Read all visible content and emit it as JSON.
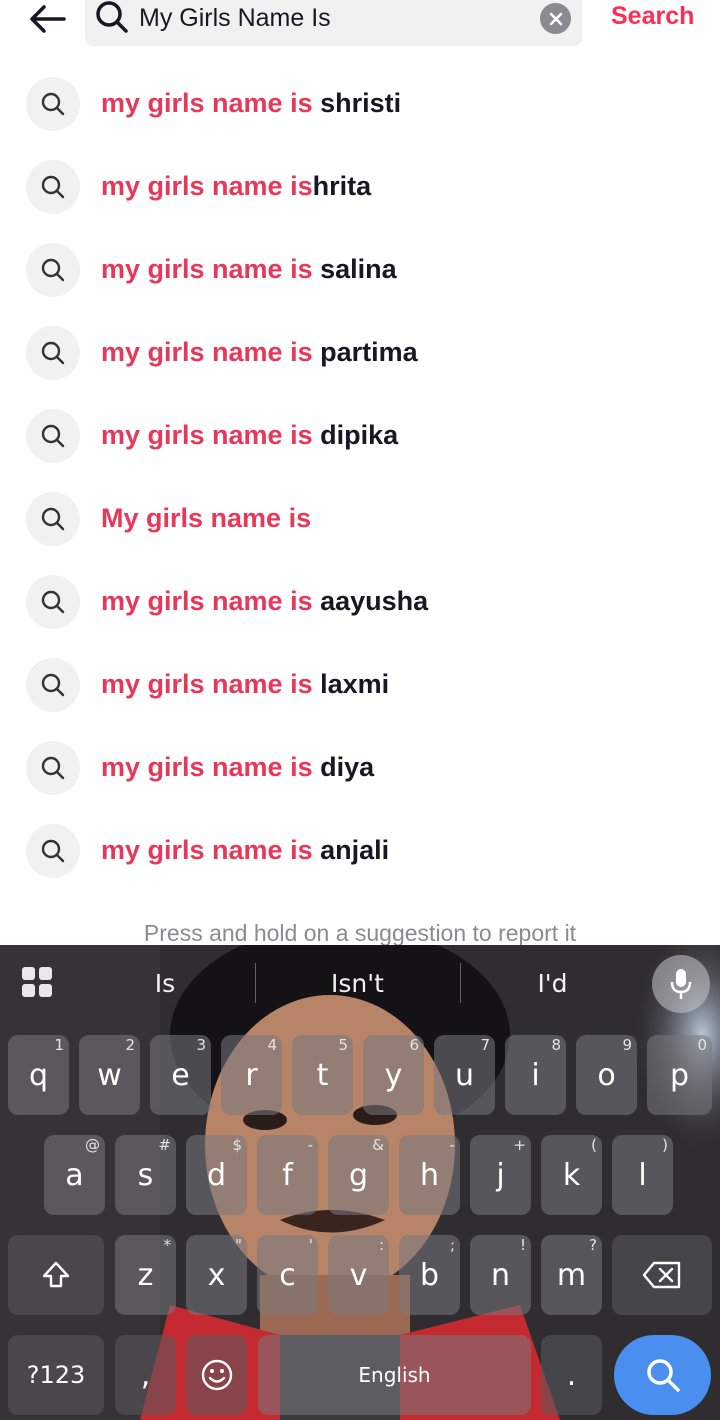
{
  "header": {
    "search_value": "My Girls Name Is",
    "search_action_label": "Search"
  },
  "suggestions": [
    {
      "highlight": "my girls name is",
      "rest": " shristi"
    },
    {
      "highlight": "my girls name is",
      "rest": "hrita"
    },
    {
      "highlight": "my girls name is",
      "rest": " salina"
    },
    {
      "highlight": "my girls name is",
      "rest": " partima"
    },
    {
      "highlight": "my girls name is",
      "rest": " dipika"
    },
    {
      "highlight": "My girls name is",
      "rest": ""
    },
    {
      "highlight": "my girls name is",
      "rest": " aayusha"
    },
    {
      "highlight": "my girls name is",
      "rest": " laxmi"
    },
    {
      "highlight": "my girls name is",
      "rest": " diya"
    },
    {
      "highlight": "my girls name is",
      "rest": " anjali"
    }
  ],
  "report_hint": "Press and hold on a suggestion to report it",
  "keyboard": {
    "predictions": [
      "Is",
      "Isn't",
      "I'd"
    ],
    "row1": [
      {
        "k": "q",
        "h": "1"
      },
      {
        "k": "w",
        "h": "2"
      },
      {
        "k": "e",
        "h": "3"
      },
      {
        "k": "r",
        "h": "4"
      },
      {
        "k": "t",
        "h": "5"
      },
      {
        "k": "y",
        "h": "6"
      },
      {
        "k": "u",
        "h": "7"
      },
      {
        "k": "i",
        "h": "8"
      },
      {
        "k": "o",
        "h": "9"
      },
      {
        "k": "p",
        "h": "0"
      }
    ],
    "row2": [
      {
        "k": "a",
        "h": "@"
      },
      {
        "k": "s",
        "h": "#"
      },
      {
        "k": "d",
        "h": "$"
      },
      {
        "k": "f",
        "h": "-"
      },
      {
        "k": "g",
        "h": "&"
      },
      {
        "k": "h",
        "h": "-"
      },
      {
        "k": "j",
        "h": "+"
      },
      {
        "k": "k",
        "h": "("
      },
      {
        "k": "l",
        "h": ")"
      }
    ],
    "row3": [
      {
        "k": "z",
        "h": "*"
      },
      {
        "k": "x",
        "h": "\""
      },
      {
        "k": "c",
        "h": "'"
      },
      {
        "k": "v",
        "h": ":"
      },
      {
        "k": "b",
        "h": ";"
      },
      {
        "k": "n",
        "h": "!"
      },
      {
        "k": "m",
        "h": "?"
      }
    ],
    "symbols_label": "?123",
    "comma_label": ",",
    "space_label": "English",
    "period_label": "."
  },
  "colors": {
    "accent": "#fe2c55",
    "highlight": "#e8385a",
    "keyboard_action": "#4a8ff0"
  }
}
